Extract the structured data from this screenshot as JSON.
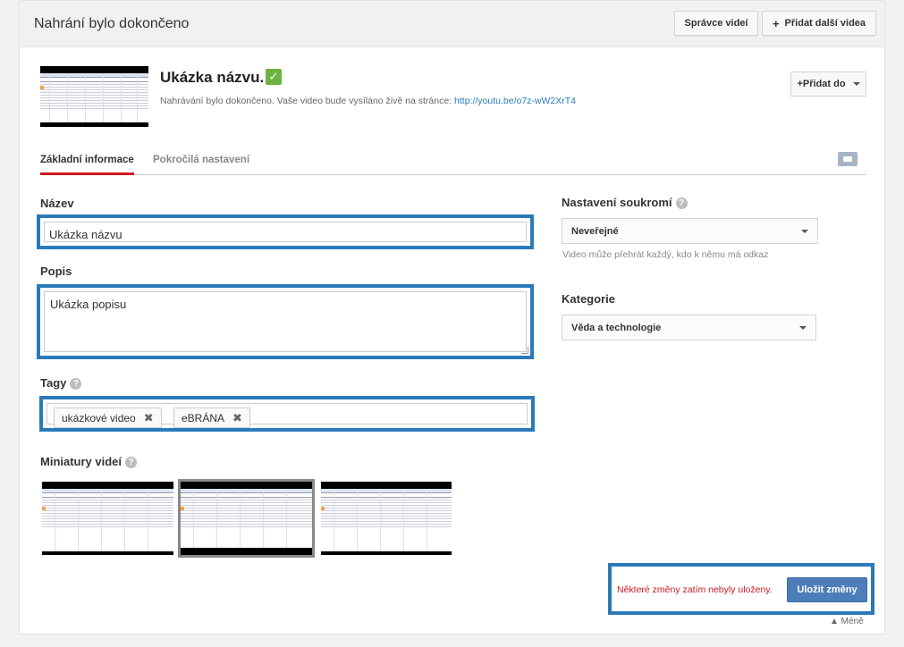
{
  "header": {
    "title": "Nahrání bylo dokončeno",
    "video_manager_label": "Správce videí",
    "add_more_label": "Přidat další videa",
    "add_more_icon": "plus-icon"
  },
  "video": {
    "title": "Ukázka názvu.",
    "status_text": "Nahrávání bylo dokončeno. Vaše video bude vysíláno živě na stránce: ",
    "link": "http://youtu.be/o7z-wW2XrT4",
    "add_to_label": "Přidat do",
    "check_icon": "checkmark-icon"
  },
  "tabs": [
    {
      "label": "Základní informace",
      "active": true
    },
    {
      "label": "Pokročilá nastavení",
      "active": false
    }
  ],
  "form": {
    "title_label": "Název",
    "title_value": "Ukázka názvu",
    "description_label": "Popis",
    "description_value": "Ukázka popisu",
    "tags_label": "Tagy",
    "tags": [
      "ukázkové video",
      "eBRÁNA"
    ],
    "thumbnails_label": "Miniatury videí"
  },
  "side": {
    "privacy_label": "Nastavení soukromí",
    "privacy_value": "Neveřejné",
    "privacy_note": "Video může přehrát každý, kdo k němu má odkaz",
    "category_label": "Kategorie",
    "category_value": "Věda a technologie"
  },
  "footer": {
    "unsaved_message": "Některé změny zatím nebyly uloženy.",
    "save_label": "Uložit změny",
    "less_label": "▲ Méně"
  },
  "colors": {
    "highlight": "#2a7ab8",
    "save_button": "#4d7eb9",
    "warning_text": "#cc181e",
    "check": "#6cb33f"
  }
}
